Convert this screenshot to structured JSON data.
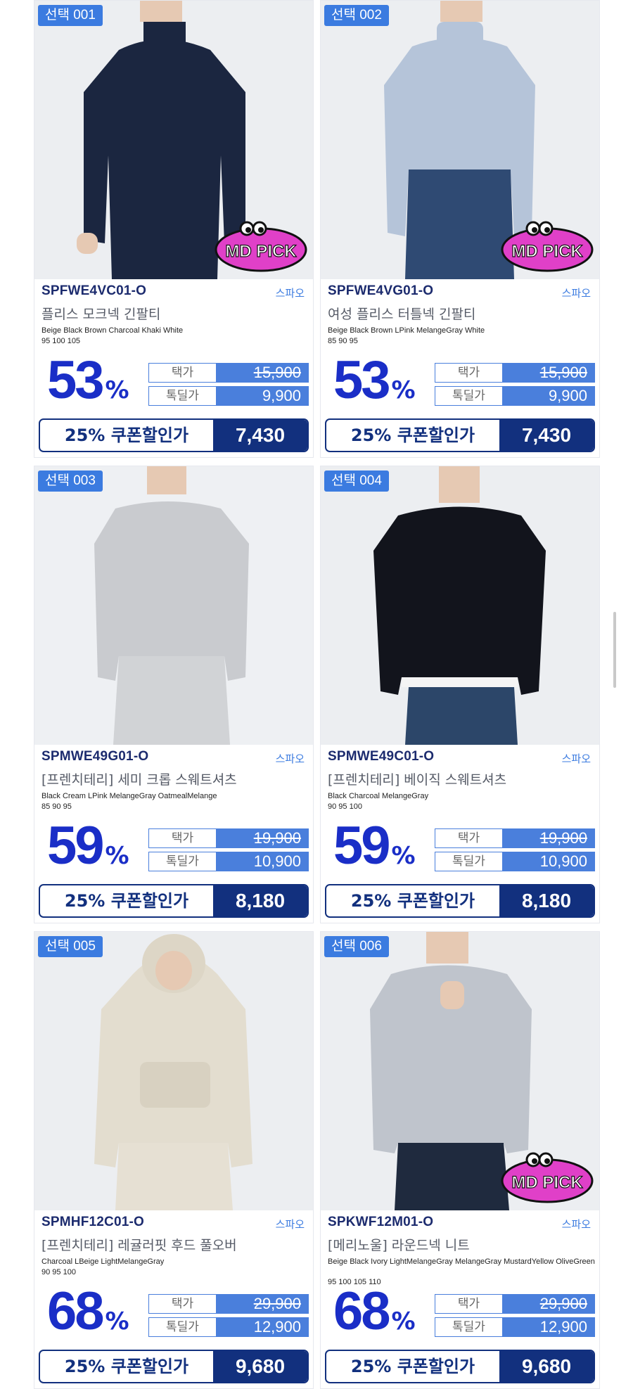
{
  "colors": {
    "accent": "#3b7be0",
    "discount": "#1a2ec7",
    "coupon": "#12307e",
    "mdpick": "#e040c8"
  },
  "common": {
    "tag_label": "택가",
    "deal_label": "톡딜가",
    "coupon_label": "25% 쿠폰할인가",
    "pct_sign": "%",
    "mdpick_text": "MD PICK"
  },
  "products": [
    {
      "select": "선택 001",
      "code": "SPFWE4VC01-O",
      "brand": "스파오",
      "name": "플리스 모크넥 긴팔티",
      "colors": "Beige Black Brown Charcoal Khaki White",
      "sizes": "95 100 105",
      "pct": "53",
      "tag_price": "15,900",
      "deal_price": "9,900",
      "coupon_price": "7,430",
      "md_pick": true
    },
    {
      "select": "선택 002",
      "code": "SPFWE4VG01-O",
      "brand": "스파오",
      "name": "여성 플리스 터틀넥 긴팔티",
      "colors": "Beige Black Brown LPink MelangeGray White",
      "sizes": "85 90 95",
      "pct": "53",
      "tag_price": "15,900",
      "deal_price": "9,900",
      "coupon_price": "7,430",
      "md_pick": true
    },
    {
      "select": "선택 003",
      "code": "SPMWE49G01-O",
      "brand": "스파오",
      "name": "[프렌치테리] 세미 크롭 스웨트셔츠",
      "colors": "Black Cream LPink MelangeGray OatmealMelange",
      "sizes": "85 90 95",
      "pct": "59",
      "tag_price": "19,900",
      "deal_price": "10,900",
      "coupon_price": "8,180",
      "md_pick": false
    },
    {
      "select": "선택 004",
      "code": "SPMWE49C01-O",
      "brand": "스파오",
      "name": "[프렌치테리] 베이직 스웨트셔츠",
      "colors": "Black Charcoal MelangeGray",
      "sizes": "90 95 100",
      "pct": "59",
      "tag_price": "19,900",
      "deal_price": "10,900",
      "coupon_price": "8,180",
      "md_pick": false
    },
    {
      "select": "선택 005",
      "code": "SPMHF12C01-O",
      "brand": "스파오",
      "name": "[프렌치테리] 레귤러핏 후드 풀오버",
      "colors": "Charcoal LBeige LightMelangeGray",
      "sizes": "90 95 100",
      "pct": "68",
      "tag_price": "29,900",
      "deal_price": "12,900",
      "coupon_price": "9,680",
      "md_pick": false
    },
    {
      "select": "선택 006",
      "code": "SPKWF12M01-O",
      "brand": "스파오",
      "name": "[메리노울] 라운드넥 니트",
      "colors": "Beige Black Ivory LightMelangeGray MelangeGray MustardYellow OliveGreen",
      "sizes": "95 100 105 110",
      "pct": "68",
      "tag_price": "29,900",
      "deal_price": "12,900",
      "coupon_price": "9,680",
      "md_pick": true
    }
  ]
}
